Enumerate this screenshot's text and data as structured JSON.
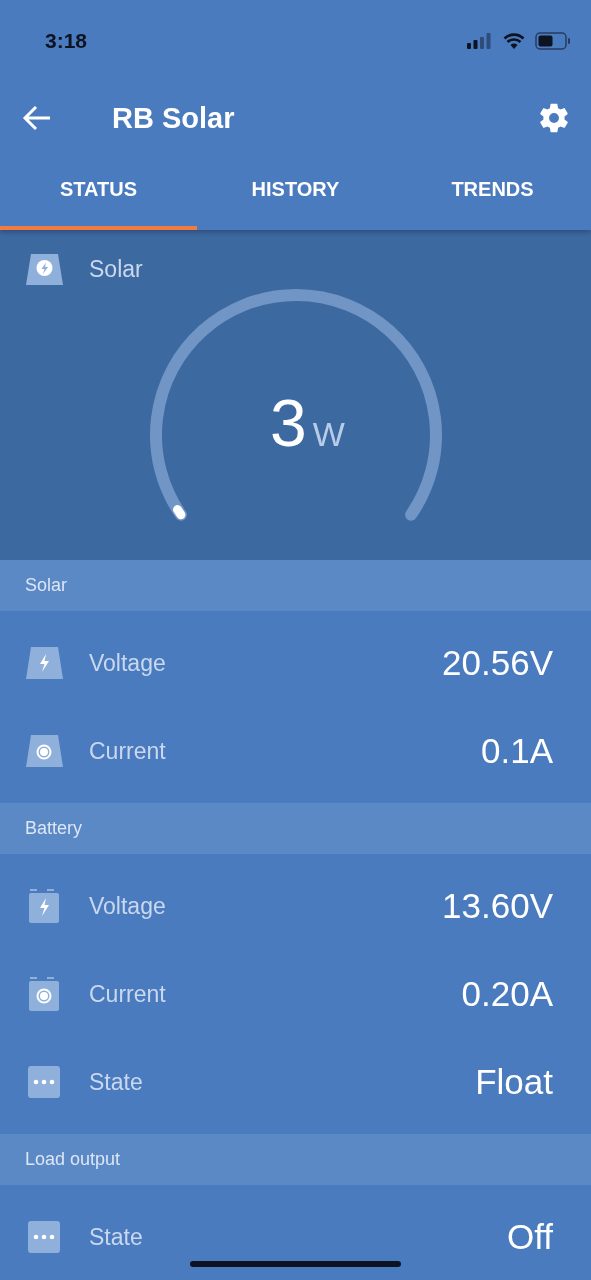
{
  "status_bar": {
    "time": "3:18"
  },
  "toolbar": {
    "title": "RB Solar"
  },
  "tabs": [
    {
      "label": "STATUS",
      "selected": true
    },
    {
      "label": "HISTORY",
      "selected": false
    },
    {
      "label": "TRENDS",
      "selected": false
    }
  ],
  "gauge": {
    "label": "Solar",
    "value": "3",
    "unit": "W"
  },
  "sections": [
    {
      "title": "Solar",
      "rows": [
        {
          "kind": "panelbolt",
          "label": "Voltage",
          "value": "20.56V"
        },
        {
          "kind": "panelcurrent",
          "label": "Current",
          "value": "0.1A"
        }
      ]
    },
    {
      "title": "Battery",
      "rows": [
        {
          "kind": "batterybolt",
          "label": "Voltage",
          "value": "13.60V"
        },
        {
          "kind": "batterycurrent",
          "label": "Current",
          "value": "0.20A"
        },
        {
          "kind": "state",
          "label": "State",
          "value": "Float"
        }
      ]
    },
    {
      "title": "Load output",
      "rows": [
        {
          "kind": "state",
          "label": "State",
          "value": "Off"
        }
      ]
    }
  ]
}
